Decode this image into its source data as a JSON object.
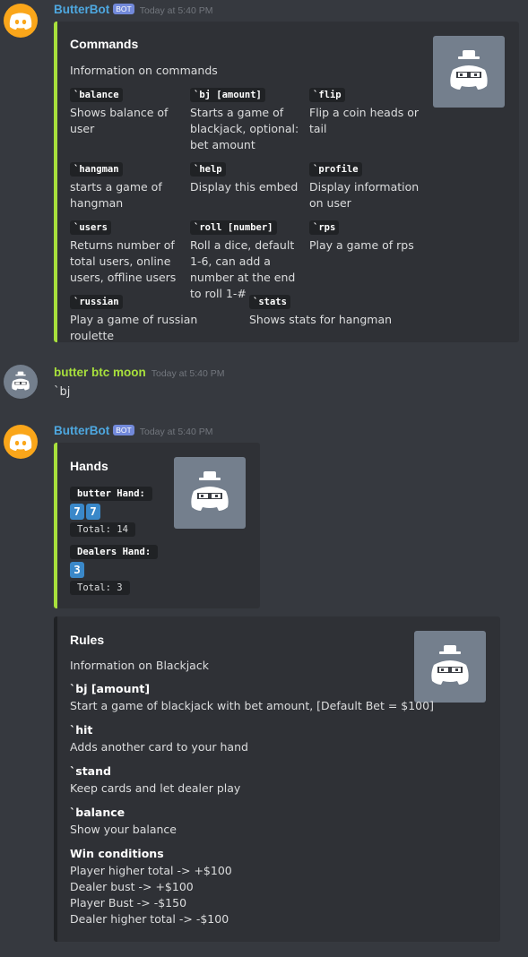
{
  "colors": {
    "background": "#36393f",
    "embed_bg": "#2f3136",
    "accent_green": "#a8e03c",
    "bot_name_color": "#4ea8e0",
    "user_name_color": "#a8e03c",
    "badge_color": "#7289da",
    "card_blue": "#3a88c9"
  },
  "msg1": {
    "author": "ButterBot",
    "badge": "BOT",
    "timestamp": "Today at 5:40 PM",
    "avatar_icon": "discord-logo-icon",
    "embed": {
      "title": "Commands",
      "description": "Information on commands",
      "thumbnail_icon": "butter-bot-avatar-icon",
      "fields": [
        {
          "name": "`balance",
          "value": "Shows balance of user"
        },
        {
          "name": "`bj [amount]",
          "value": "Starts a game of blackjack, optional: bet amount"
        },
        {
          "name": "`flip",
          "value": "Flip a coin heads or tail"
        },
        {
          "name": "`hangman",
          "value": "starts a game of hangman"
        },
        {
          "name": "`help",
          "value": "Display this embed"
        },
        {
          "name": "`profile",
          "value": "Display information on user"
        },
        {
          "name": "`users",
          "value": "Returns number of total users, online users, offline users"
        },
        {
          "name": "`roll [number]",
          "value": "Roll a dice, default 1-6, can add a number at the end to roll 1-#"
        },
        {
          "name": "`rps",
          "value": "Play a game of rps"
        },
        {
          "name": "`russian",
          "value": "Play a game of russian roulette"
        },
        {
          "name": "`stats",
          "value": "Shows stats for hangman"
        }
      ]
    }
  },
  "msg2": {
    "author": "butter btc moon",
    "timestamp": "Today at 5:40 PM",
    "avatar_icon": "butter-bot-avatar-icon",
    "text": "`bj"
  },
  "msg3": {
    "author": "ButterBot",
    "badge": "BOT",
    "timestamp": "Today at 5:40 PM",
    "avatar_icon": "discord-logo-icon",
    "hands": {
      "title": "Hands",
      "thumbnail_icon": "butter-bot-avatar-icon",
      "player_label": "butter Hand:",
      "player_cards": [
        "7",
        "7"
      ],
      "player_total": "Total: 14",
      "dealer_label": "Dealers Hand:",
      "dealer_cards": [
        "3"
      ],
      "dealer_total": "Total: 3"
    },
    "rules": {
      "title": "Rules",
      "description": "Information on Blackjack",
      "thumbnail_icon": "butter-bot-avatar-icon",
      "fields": [
        {
          "name": "`bj [amount]",
          "value": "Start a game of blackjack with bet amount, [Default Bet = $100]"
        },
        {
          "name": "`hit",
          "value": "Adds another card to your hand"
        },
        {
          "name": "`stand",
          "value": "Keep cards and let dealer play"
        },
        {
          "name": "`balance",
          "value": "Show your balance"
        }
      ],
      "win_title": "Win conditions",
      "win_lines": [
        "Player higher total -> +$100",
        "Dealer bust -> +$100",
        "Player Bust -> -$150",
        "Dealer higher total -> -$100"
      ]
    }
  }
}
